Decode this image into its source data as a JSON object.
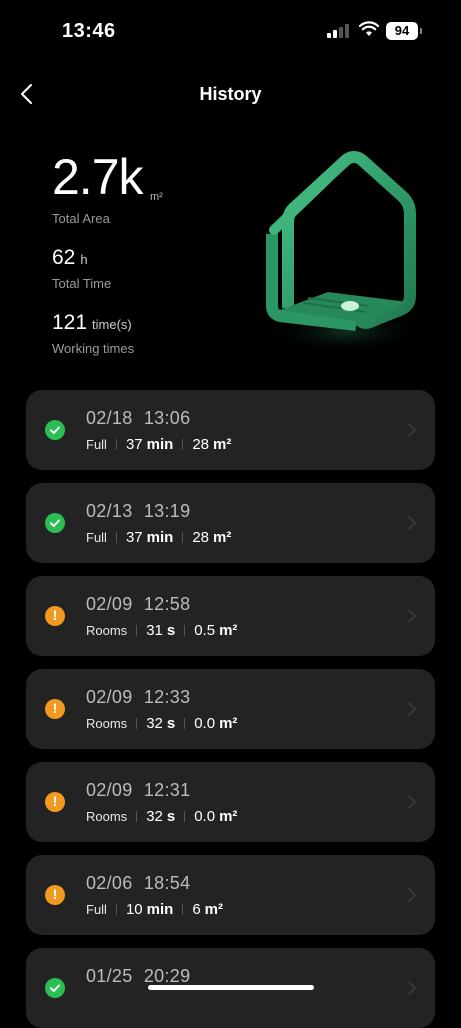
{
  "status_bar": {
    "time": "13:46",
    "battery": "94"
  },
  "header": {
    "title": "History"
  },
  "summary": {
    "area_value": "2.7k",
    "area_unit": "m²",
    "area_label": "Total Area",
    "time_value": "62",
    "time_unit": "h",
    "time_label": "Total Time",
    "count_value": "121",
    "count_unit": "time(s)",
    "count_label": "Working times"
  },
  "colors": {
    "success": "#2cbe52",
    "warning": "#f29a1f",
    "card": "#232323",
    "house": "#2e9a68"
  },
  "records": [
    {
      "date": "02/18",
      "time": "13:06",
      "status": "success",
      "mode": "Full",
      "duration_value": "37",
      "duration_unit": "min",
      "area_value": "28",
      "area_unit": "m²"
    },
    {
      "date": "02/13",
      "time": "13:19",
      "status": "success",
      "mode": "Full",
      "duration_value": "37",
      "duration_unit": "min",
      "area_value": "28",
      "area_unit": "m²"
    },
    {
      "date": "02/09",
      "time": "12:58",
      "status": "warning",
      "mode": "Rooms",
      "duration_value": "31",
      "duration_unit": "s",
      "area_value": "0.5",
      "area_unit": "m²"
    },
    {
      "date": "02/09",
      "time": "12:33",
      "status": "warning",
      "mode": "Rooms",
      "duration_value": "32",
      "duration_unit": "s",
      "area_value": "0.0",
      "area_unit": "m²"
    },
    {
      "date": "02/09",
      "time": "12:31",
      "status": "warning",
      "mode": "Rooms",
      "duration_value": "32",
      "duration_unit": "s",
      "area_value": "0.0",
      "area_unit": "m²"
    },
    {
      "date": "02/06",
      "time": "18:54",
      "status": "warning",
      "mode": "Full",
      "duration_value": "10",
      "duration_unit": "min",
      "area_value": "6",
      "area_unit": "m²"
    },
    {
      "date": "01/25",
      "time": "20:29",
      "status": "success",
      "mode": "",
      "duration_value": "",
      "duration_unit": "",
      "area_value": "",
      "area_unit": ""
    }
  ]
}
